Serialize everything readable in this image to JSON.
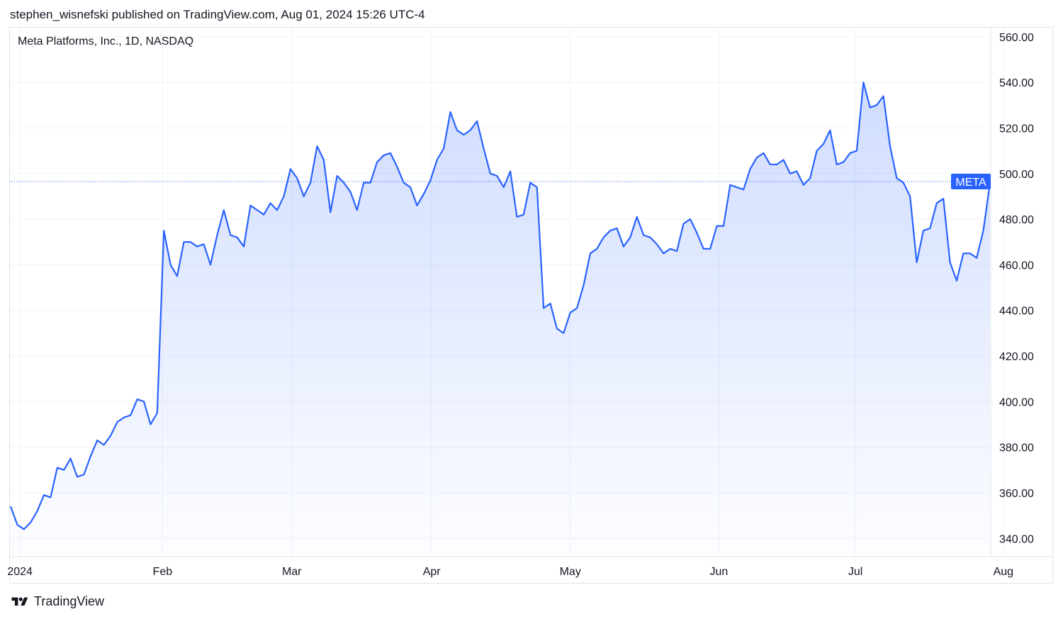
{
  "header": {
    "published": "stephen_wisnefski published on TradingView.com, Aug 01, 2024 15:26 UTC-4"
  },
  "symbol": {
    "title": "Meta Platforms, Inc., 1D, NASDAQ",
    "tag": "META"
  },
  "footer": {
    "brand": "TradingView",
    "logo_icon": "tradingview-logo-icon"
  },
  "colors": {
    "line": "#2962ff",
    "tag_bg": "#2962ff",
    "grid": "#f0f3fa",
    "text": "#131722"
  },
  "chart_data": {
    "type": "area",
    "series": [
      {
        "values": [
          354,
          346,
          344,
          347,
          352,
          359,
          358,
          371,
          370,
          375,
          367,
          368,
          376,
          383,
          381,
          385,
          391,
          393,
          394,
          401,
          400,
          390,
          395,
          475,
          460,
          455,
          470,
          470,
          468,
          469,
          460,
          473,
          484,
          473,
          472,
          468,
          486,
          484,
          482,
          487,
          484,
          490,
          502,
          498,
          490,
          496,
          512,
          506,
          483,
          499,
          496,
          492,
          484,
          496,
          496,
          505,
          508,
          509,
          503,
          496,
          494,
          486,
          491,
          497,
          506,
          511,
          527,
          519,
          517,
          519,
          523,
          511,
          500,
          499,
          494,
          501,
          481,
          482,
          496,
          494,
          441,
          443,
          432,
          430,
          439,
          441,
          451,
          465,
          467,
          472,
          475,
          476,
          468,
          472,
          481,
          473,
          472,
          469,
          465,
          467,
          466,
          478,
          480,
          474,
          467,
          467,
          477,
          477,
          495,
          494,
          493,
          502,
          507,
          509,
          504,
          504,
          506,
          500,
          501,
          495,
          498,
          510,
          513,
          519,
          504,
          505,
          509,
          510,
          540,
          529,
          530,
          534,
          512,
          498,
          496,
          490,
          461,
          475,
          476,
          487,
          489,
          461,
          453,
          465,
          465,
          463,
          475,
          496
        ]
      }
    ],
    "last_value": 496.5,
    "ylim": [
      332,
      564
    ],
    "y_ticks": [
      340,
      360,
      380,
      400,
      420,
      440,
      460,
      480,
      500,
      520,
      540,
      560
    ],
    "y_tick_labels": [
      "340.00",
      "360.00",
      "380.00",
      "400.00",
      "420.00",
      "440.00",
      "460.00",
      "480.00",
      "500.00",
      "520.00",
      "540.00",
      "560.00"
    ],
    "x_ticks": [
      {
        "label": "2024",
        "index": 1.4
      },
      {
        "label": "Feb",
        "index": 22.8
      },
      {
        "label": "Mar",
        "index": 42.2
      },
      {
        "label": "Apr",
        "index": 63.2
      },
      {
        "label": "May",
        "index": 84.0
      },
      {
        "label": "Jun",
        "index": 106.3
      },
      {
        "label": "Jul",
        "index": 126.8
      },
      {
        "label": "Aug",
        "index": 149.0
      }
    ],
    "grid": true
  }
}
